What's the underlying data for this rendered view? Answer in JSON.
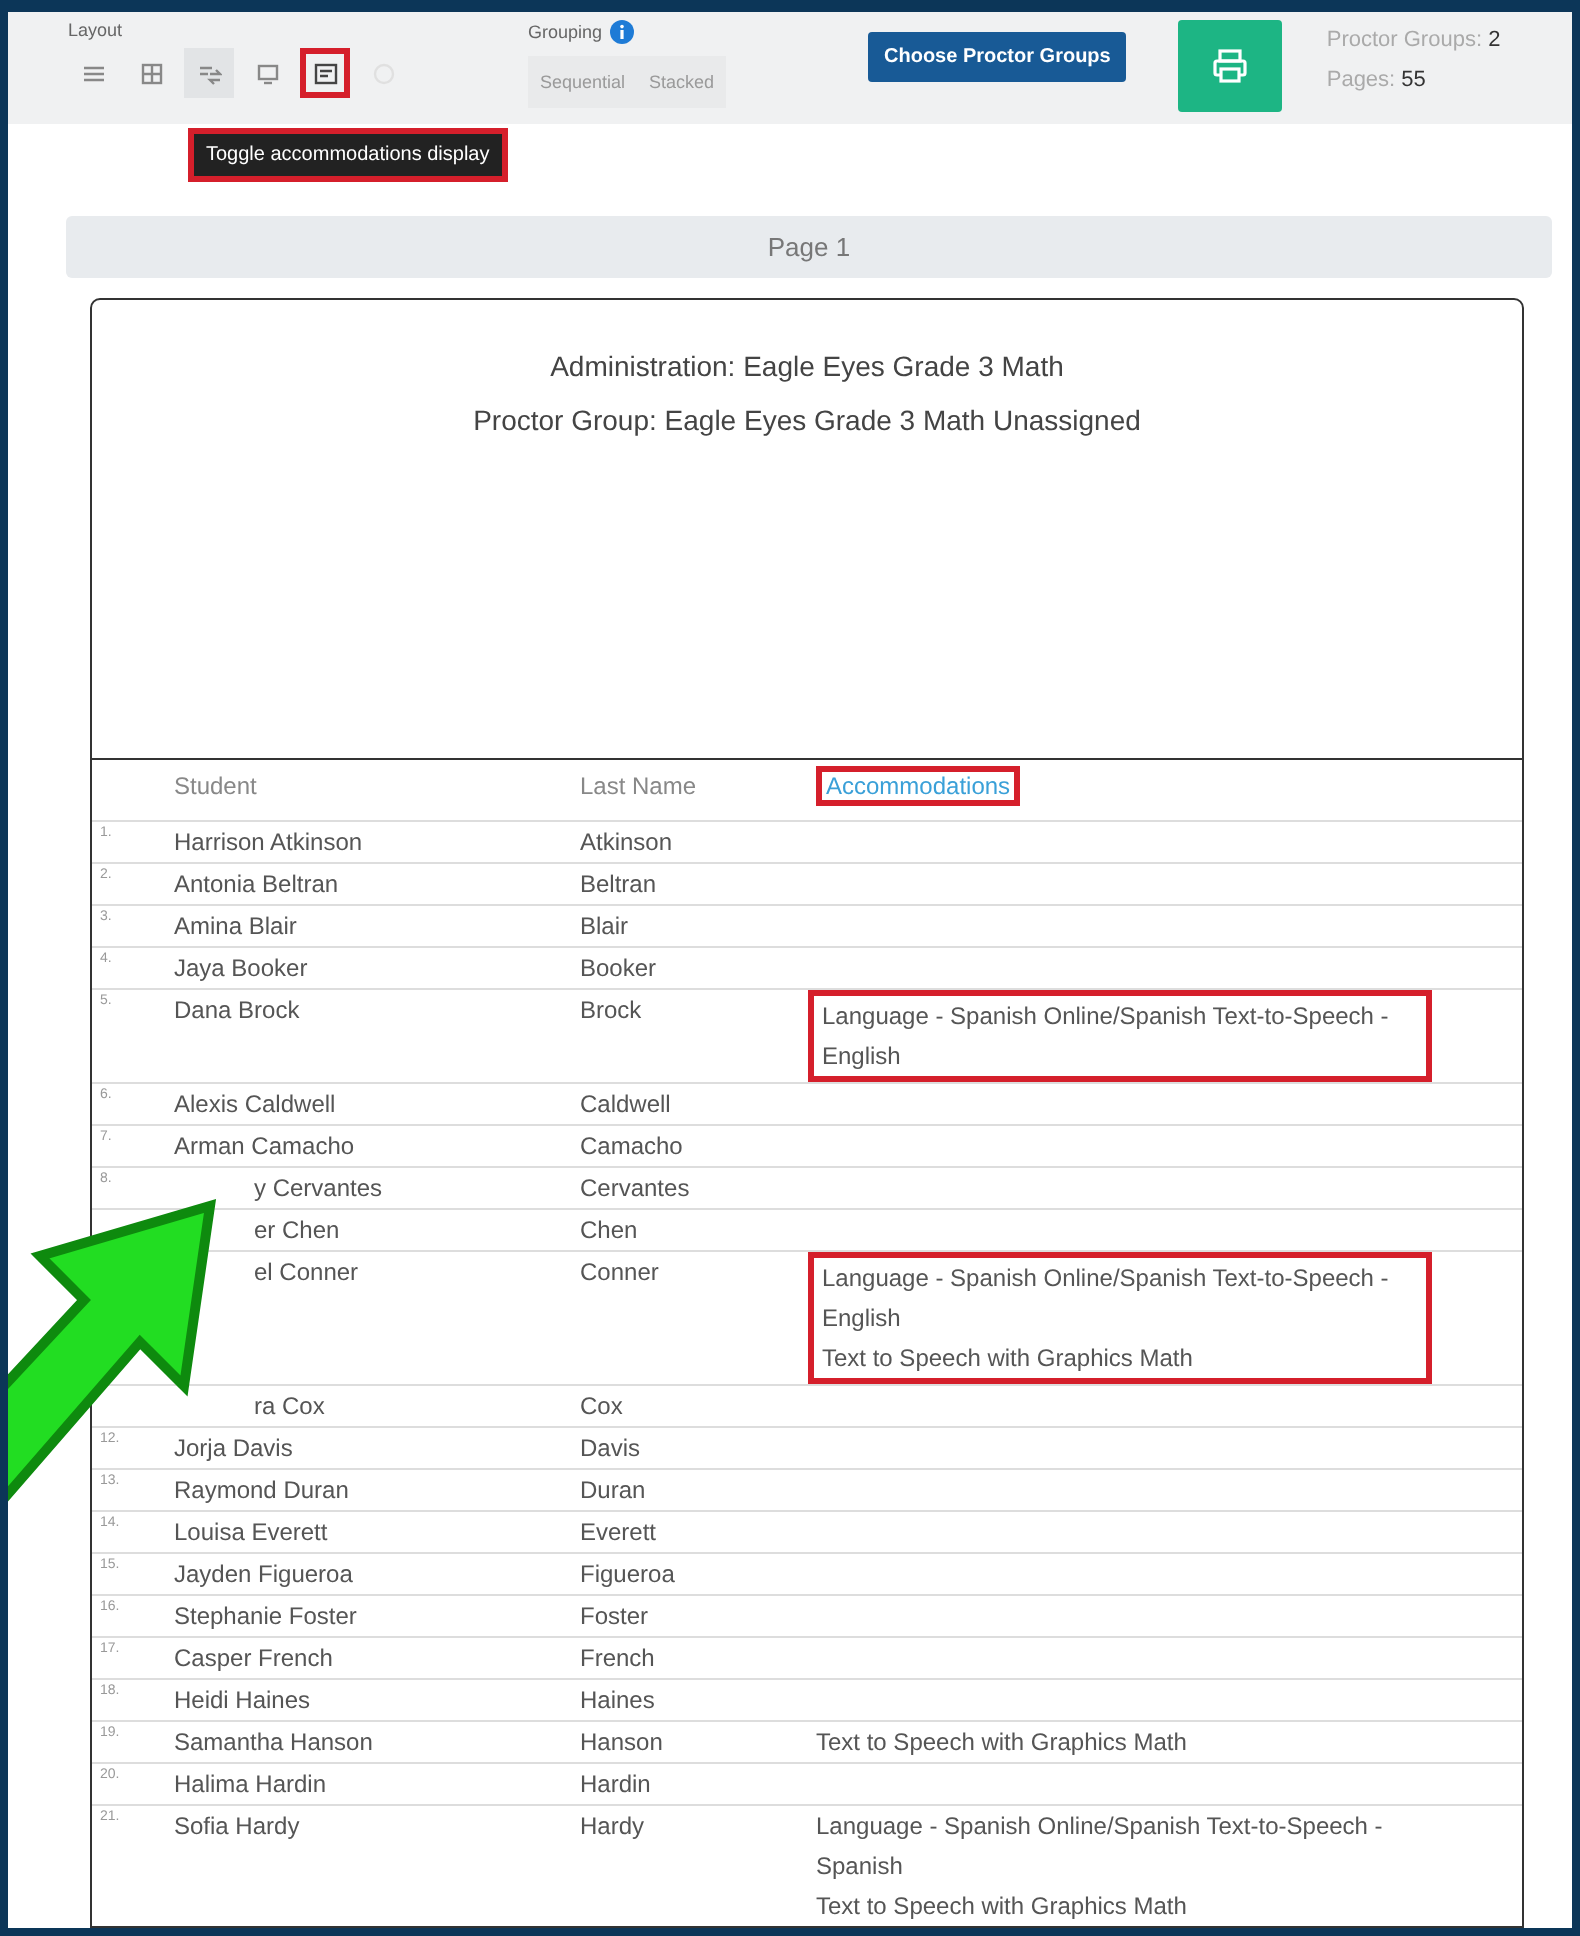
{
  "toolbar": {
    "layout_label": "Layout",
    "layout_buttons": [
      {
        "kind": "list",
        "selected": false,
        "highlighted": false,
        "disabled": false
      },
      {
        "kind": "grid",
        "selected": false,
        "highlighted": false,
        "disabled": false
      },
      {
        "kind": "sort",
        "selected": true,
        "highlighted": false,
        "disabled": false
      },
      {
        "kind": "monitor",
        "selected": false,
        "highlighted": false,
        "disabled": false
      },
      {
        "kind": "card",
        "selected": false,
        "highlighted": true,
        "disabled": false
      },
      {
        "kind": "circle",
        "selected": false,
        "highlighted": false,
        "disabled": true
      }
    ],
    "tooltip": "Toggle accommodations display",
    "grouping_label": "Grouping",
    "grouping_buttons": [
      {
        "label": "Sequential",
        "disabled": true
      },
      {
        "label": "Stacked",
        "disabled": true
      }
    ],
    "choose_button": "Choose Proctor Groups",
    "proctor_groups_label": "Proctor Groups:",
    "proctor_groups_value": "2",
    "pages_label": "Pages:",
    "pages_value": "55"
  },
  "page_title": "Page 1",
  "header_lines": [
    "Administration: Eagle Eyes Grade 3 Math",
    "Proctor Group: Eagle Eyes Grade 3 Math Unassigned"
  ],
  "table": {
    "columns": [
      {
        "label": "Student",
        "highlighted": false
      },
      {
        "label": "Last Name",
        "highlighted": false
      },
      {
        "label": "Accommodations",
        "highlighted": true
      }
    ],
    "rows": [
      {
        "number": "1.",
        "student": "Harrison Atkinson",
        "last_name": "Atkinson",
        "partly_hidden": false
      },
      {
        "number": "2.",
        "student": "Antonia Beltran",
        "last_name": "Beltran",
        "partly_hidden": false
      },
      {
        "number": "3.",
        "student": "Amina Blair",
        "last_name": "Blair",
        "partly_hidden": false
      },
      {
        "number": "4.",
        "student": "Jaya Booker",
        "last_name": "Booker",
        "partly_hidden": false
      },
      {
        "number": "5.",
        "student": "Dana Brock",
        "last_name": "Brock",
        "partly_hidden": false,
        "accommodations": [
          "Language - Spanish Online/Spanish Text-to-Speech - English"
        ],
        "highlighted": true
      },
      {
        "number": "6.",
        "student": "Alexis Caldwell",
        "last_name": "Caldwell",
        "partly_hidden": false
      },
      {
        "number": "7.",
        "student": "Arman Camacho",
        "last_name": "Camacho",
        "partly_hidden": false
      },
      {
        "number": "8.",
        "student": "y Cervantes",
        "last_name": "Cervantes",
        "partly_hidden": true
      },
      {
        "student": "er Chen",
        "last_name": "Chen",
        "partly_hidden": true
      },
      {
        "student": "el Conner",
        "last_name": "Conner",
        "partly_hidden": true,
        "accommodations": [
          "Language - Spanish Online/Spanish Text-to-Speech - English",
          "Text to Speech with Graphics Math"
        ],
        "highlighted": true
      },
      {
        "student": "ra Cox",
        "last_name": "Cox",
        "partly_hidden": true
      },
      {
        "number": "12.",
        "student": "Jorja Davis",
        "last_name": "Davis",
        "partly_hidden": false
      },
      {
        "number": "13.",
        "student": "Raymond Duran",
        "last_name": "Duran",
        "partly_hidden": false
      },
      {
        "number": "14.",
        "student": "Louisa Everett",
        "last_name": "Everett",
        "partly_hidden": false
      },
      {
        "number": "15.",
        "student": "Jayden Figueroa",
        "last_name": "Figueroa",
        "partly_hidden": false
      },
      {
        "number": "16.",
        "student": "Stephanie Foster",
        "last_name": "Foster",
        "partly_hidden": false
      },
      {
        "number": "17.",
        "student": "Casper French",
        "last_name": "French",
        "partly_hidden": false
      },
      {
        "number": "18.",
        "student": "Heidi Haines",
        "last_name": "Haines",
        "partly_hidden": false
      },
      {
        "number": "19.",
        "student": "Samantha Hanson",
        "last_name": "Hanson",
        "partly_hidden": false,
        "accommodations": [
          "Text to Speech with Graphics Math"
        ],
        "highlighted": false
      },
      {
        "number": "20.",
        "student": "Halima Hardin",
        "last_name": "Hardin",
        "partly_hidden": false
      },
      {
        "number": "21.",
        "student": "Sofia Hardy",
        "last_name": "Hardy",
        "partly_hidden": false,
        "accommodations": [
          "Language - Spanish Online/Spanish Text-to-Speech - Spanish",
          "Text to Speech with Graphics Math"
        ],
        "highlighted": false
      }
    ]
  }
}
